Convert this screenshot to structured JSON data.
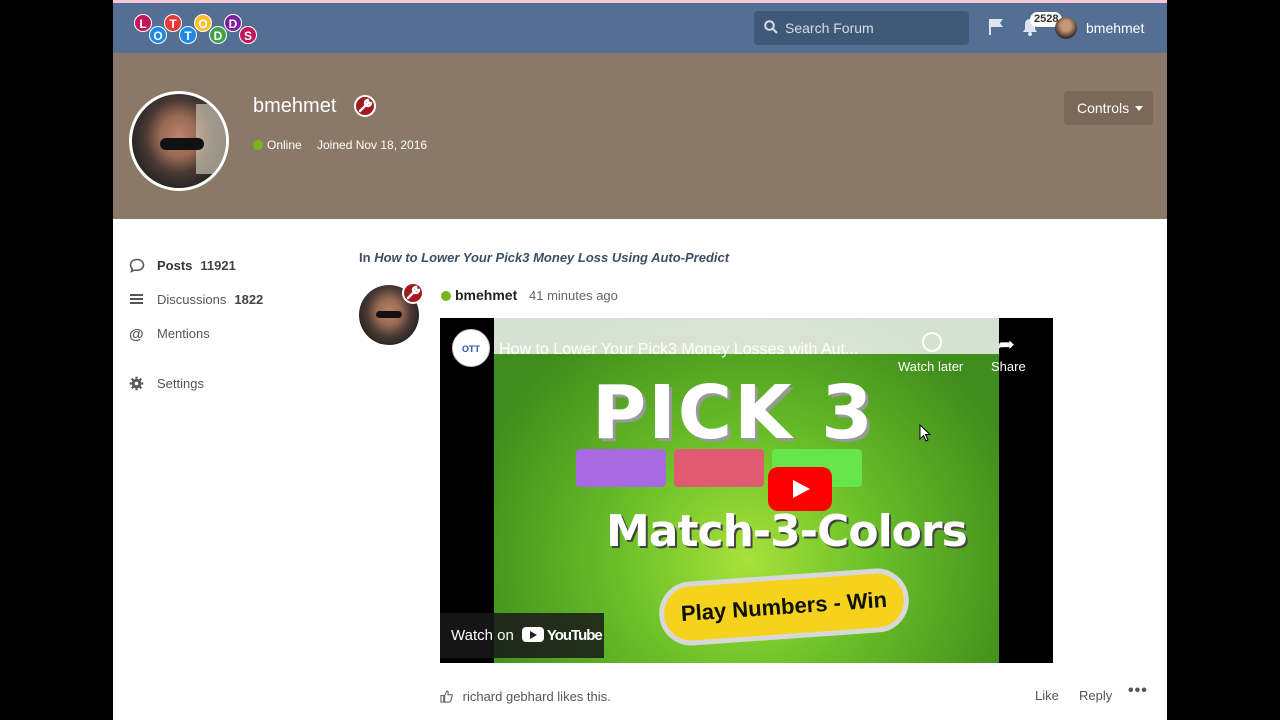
{
  "brand": {
    "logo_letters": [
      "L",
      "O",
      "T",
      "T",
      "O",
      "D",
      "D",
      "S"
    ]
  },
  "header": {
    "search_placeholder": "Search Forum",
    "notification_count": "2528",
    "username": "bmehmet"
  },
  "profile": {
    "name": "bmehmet",
    "status": "Online",
    "joined": "Joined Nov 18, 2016",
    "controls_label": "Controls"
  },
  "sidebar": {
    "items": [
      {
        "label": "Posts",
        "count": "11921",
        "icon": "comment-icon"
      },
      {
        "label": "Discussions",
        "count": "1822",
        "icon": "list-icon"
      },
      {
        "label": "Mentions",
        "count": "",
        "icon": "at-icon"
      },
      {
        "label": "Settings",
        "count": "",
        "icon": "gear-icon"
      }
    ]
  },
  "post": {
    "in_prefix": "In",
    "thread_title": "How to Lower Your Pick3 Money Loss Using Auto-Predict",
    "author": "bmehmet",
    "time": "41 minutes ago",
    "likes_text": "richard gebhard likes this.",
    "like_label": "Like",
    "reply_label": "Reply",
    "more_label": "•••"
  },
  "video": {
    "title": "How to Lower Your Pick3 Money Losses with Aut...",
    "channel_badge": "OTT",
    "watch_later": "Watch later",
    "share": "Share",
    "thumb_headline": "PICK 3",
    "thumb_subline": "Match-3-Colors",
    "thumb_button": "Play Numbers - Win",
    "watch_on": "Watch on",
    "youtube": "YouTube",
    "box_colors": [
      "#a86ae0",
      "#e05a72",
      "#66e64a"
    ]
  },
  "colors": {
    "topbar": "#546f94",
    "cover": "#8b7967",
    "online": "#7ab51d",
    "wrench": "#a01a1f"
  }
}
